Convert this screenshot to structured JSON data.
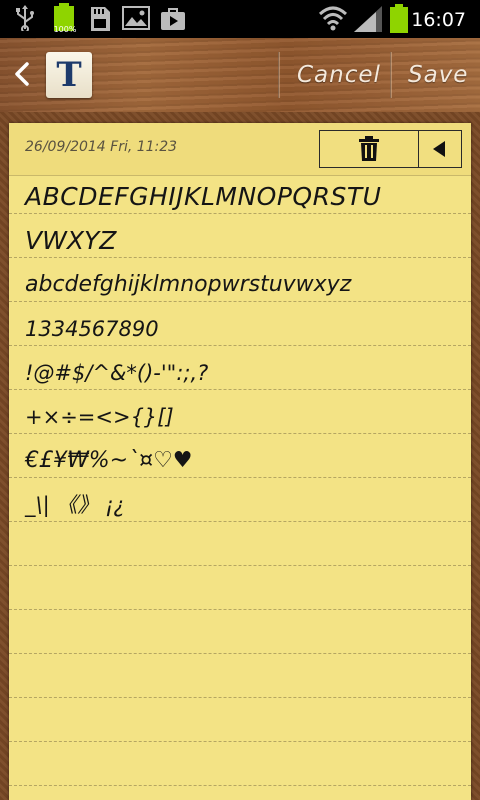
{
  "status_bar": {
    "time": "16:07",
    "battery_icon_label": "100%",
    "icons": [
      "usb-icon",
      "battery-small-icon",
      "sd-card-icon",
      "gallery-icon",
      "briefcase-icon",
      "wifi-icon",
      "signal-icon",
      "battery-icon"
    ]
  },
  "toolbar": {
    "font_button_letter": "T",
    "cancel_label": "Cancel",
    "save_label": "Save"
  },
  "note": {
    "date": "26/09/2014 Fri, 11:23",
    "lines": [
      "ABCDEFGHIJKLMNOPQRSTU",
      "VWXYZ",
      "abcdefghijklmnopwrstuvwxyz",
      "1334567890",
      "!@#$/^&*()-'\":;,?",
      "+×÷=<>{}[]",
      "€£¥₩%~`¤♡♥",
      "_\\| 《》 ¡¿"
    ]
  },
  "colors": {
    "paper": "#f3e385",
    "wood": "#9c6436",
    "cork": "#7b4a26",
    "battery_green": "#8fd400"
  }
}
